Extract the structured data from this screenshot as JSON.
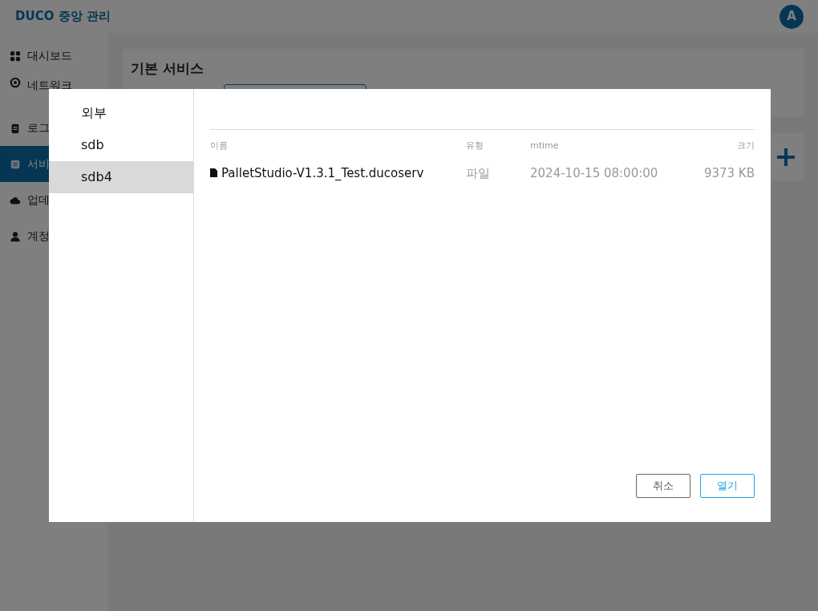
{
  "app": {
    "title": "DUCO 중앙 관리",
    "avatar": "A"
  },
  "sidebar": {
    "items": [
      {
        "label": "대시보드",
        "kind": "grid",
        "selected": false
      },
      {
        "label": "네트워크",
        "kind": "target",
        "selected": false
      },
      {
        "label": "로그",
        "kind": "clipboard",
        "selected": false
      },
      {
        "label": "서비",
        "kind": "doc",
        "selected": true
      },
      {
        "label": "업데",
        "kind": "cloud",
        "selected": false
      },
      {
        "label": "계정",
        "kind": "user",
        "selected": false
      }
    ]
  },
  "main": {
    "section_title": "기본 서비스"
  },
  "dialog": {
    "locations": [
      {
        "label": "외부",
        "selected": false
      },
      {
        "label": "sdb",
        "selected": false
      },
      {
        "label": "sdb4",
        "selected": true
      }
    ],
    "columns": [
      "이름",
      "유형",
      "mtime",
      "크기"
    ],
    "rows": [
      {
        "name": "PalletStudio-V1.3.1_Test.ducoserv",
        "type": "파일",
        "mtime": "2024-10-15 08:00:00",
        "size": "9373 KB"
      }
    ],
    "buttons": [
      {
        "label": "취소",
        "kind": "secondary"
      },
      {
        "label": "열기",
        "kind": "primary"
      }
    ]
  }
}
